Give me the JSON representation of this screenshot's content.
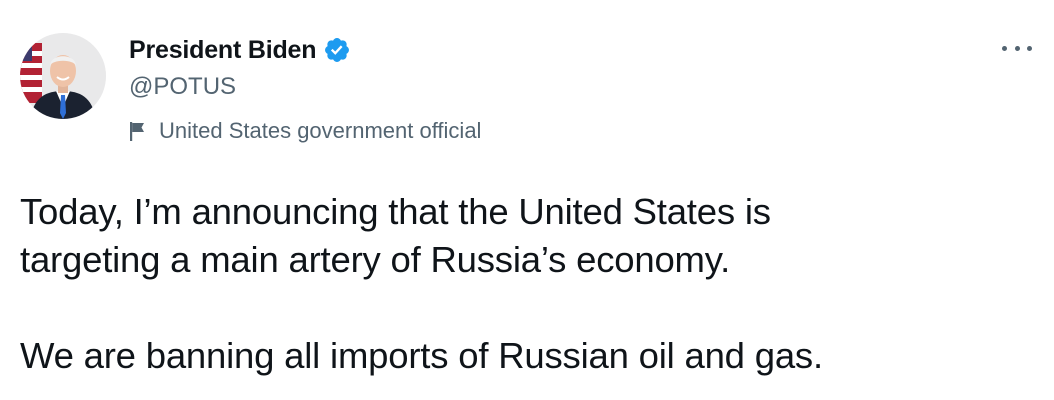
{
  "author": {
    "display_name": "President Biden",
    "handle": "@POTUS",
    "verified": true,
    "label": "United States government official",
    "label_icon": "flag-icon",
    "avatar_icon": "avatar-photo"
  },
  "menu": {
    "icon": "more-icon"
  },
  "tweet": {
    "line1": "Today, I’m announcing that the United States is",
    "line2": "targeting a main artery of Russia’s economy.",
    "line3": "We are banning all imports of Russian oil and gas."
  },
  "colors": {
    "text": "#0f1419",
    "secondary": "#536471",
    "verified_blue": "#1d9bf0"
  }
}
